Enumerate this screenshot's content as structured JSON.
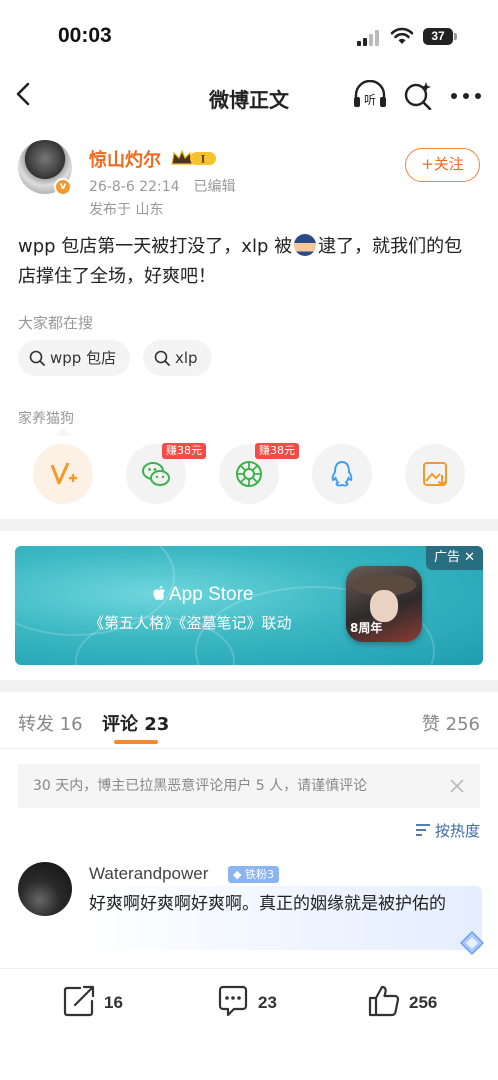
{
  "status_bar": {
    "time": "00:03",
    "battery": "37"
  },
  "nav": {
    "title": "微博正文",
    "icons": [
      "back-icon",
      "listen-icon",
      "search-ai-icon",
      "more-icon"
    ],
    "listen_label": "听"
  },
  "post": {
    "username": "惊山灼尔",
    "vip_level": "I",
    "date": "26-8-6 22:14",
    "edited": "已编辑",
    "location": "发布于 山东",
    "follow_label": "+关注",
    "text_part1": "wpp 包店第一天被打没了，xlp 被",
    "text_part2": "逮了，就我们的包店撑住了全场，好爽吧！"
  },
  "search": {
    "title": "大家都在搜",
    "chips": [
      "wpp 包店",
      "xlp"
    ]
  },
  "share": {
    "title": "家养猫狗",
    "earn_badges": [
      "赚38元",
      "赚38元"
    ]
  },
  "ad": {
    "store": "App Store",
    "slogan": "《第五人格》《盗墓笔记》联动",
    "tag": "广告 ✕",
    "game_label": "8周年"
  },
  "tabs": {
    "repost": "转发 16",
    "comment": "评论 23",
    "like": "赞 256"
  },
  "notice": {
    "text": "30 天内，博主已拉黑恶意评论用户 5 人，请谨慎评论"
  },
  "sort": {
    "label": "按热度"
  },
  "comment": {
    "user": "Waterandpower",
    "badge": "铁粉3",
    "text": "好爽啊好爽啊好爽啊。真正的姻缘就是被护佑的"
  },
  "actions": {
    "repost": "16",
    "comment": "23",
    "like": "256"
  },
  "colors": {
    "accent": "#f06a1d",
    "link": "#3c6aa8",
    "tab_underline": "#f38a2c"
  }
}
